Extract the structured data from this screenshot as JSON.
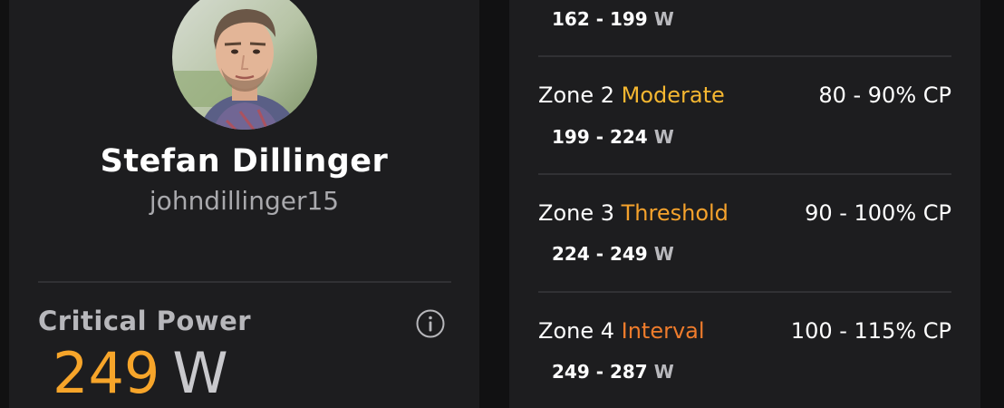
{
  "profile": {
    "name": "Stefan Dillinger",
    "username": "johndillinger15"
  },
  "critical_power": {
    "label": "Critical Power",
    "value": "249",
    "unit": "W",
    "info_icon": "info-circle-icon"
  },
  "zones": {
    "unit": "W",
    "items": [
      {
        "range": "162 - 199"
      },
      {
        "zone": "Zone 2",
        "name": "Moderate",
        "name_color": "#f5b731",
        "percent": "80 - 90% CP",
        "range": "199 - 224"
      },
      {
        "zone": "Zone 3",
        "name": "Threshold",
        "name_color": "#f5a22c",
        "percent": "90 - 100% CP",
        "range": "224 - 249"
      },
      {
        "zone": "Zone 4",
        "name": "Interval",
        "name_color": "#ef7c2c",
        "percent": "100 - 115% CP",
        "range": "249 - 287"
      }
    ]
  },
  "colors": {
    "accent_orange": "#f7a52a",
    "card_bg": "#1d1d1f",
    "page_bg": "#111112"
  }
}
